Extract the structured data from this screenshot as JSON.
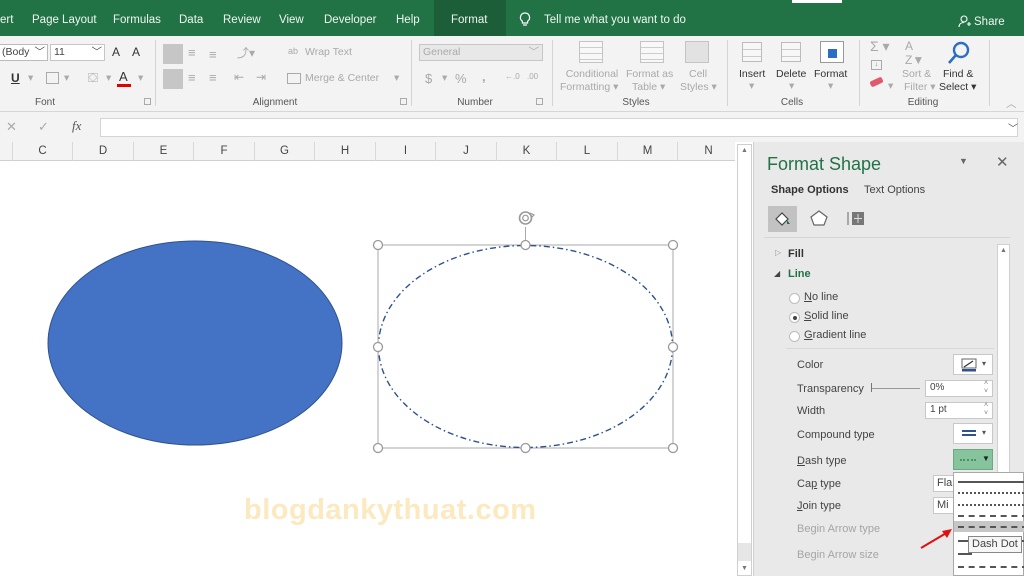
{
  "app": {
    "name": "Excel"
  },
  "tabs": [
    {
      "label": "ert"
    },
    {
      "label": "Page Layout"
    },
    {
      "label": "Formulas"
    },
    {
      "label": "Data"
    },
    {
      "label": "Review"
    },
    {
      "label": "View"
    },
    {
      "label": "Developer"
    },
    {
      "label": "Help"
    },
    {
      "label": "Format",
      "active": true
    }
  ],
  "tell_me": {
    "placeholder": "Tell me what you want to do",
    "icon": "lightbulb-icon"
  },
  "share": {
    "label": "Share",
    "icon": "person-add-icon"
  },
  "ribbon": {
    "font": {
      "label": "Font",
      "font_name": "(Body",
      "font_size": "11",
      "increase_size": "A",
      "decrease_size": "A",
      "underline": "U",
      "font_color_glyph": "A",
      "font_color": "#e00000"
    },
    "alignment": {
      "label": "Alignment",
      "wrap_text": "Wrap Text",
      "merge_center": "Merge & Center"
    },
    "number": {
      "label": "Number",
      "format": "General",
      "currency": "$",
      "percent": "%",
      "comma": ",",
      "inc_decimal": "←0 .00",
      "dec_decimal": ".00 →0"
    },
    "styles": {
      "label": "Styles",
      "conditional_formatting": [
        "Conditional",
        "Formatting ▾"
      ],
      "format_as_table": [
        "Format as",
        "Table ▾"
      ],
      "cell_styles": [
        "Cell",
        "Styles ▾"
      ]
    },
    "cells": {
      "label": "Cells",
      "insert": "Insert",
      "delete": "Delete",
      "format": "Format"
    },
    "editing": {
      "label": "Editing",
      "sort_filter": [
        "Sort &",
        "Filter ▾"
      ],
      "find_select": [
        "Find &",
        "Select ▾"
      ]
    }
  },
  "formula_bar": {
    "cancel": "✕",
    "enter": "✓",
    "fx": "fx",
    "value": ""
  },
  "columns": [
    "C",
    "D",
    "E",
    "F",
    "G",
    "H",
    "I",
    "J",
    "K",
    "L",
    "M",
    "N"
  ],
  "shapes": {
    "filled_oval": {
      "fill": "#4472c4",
      "stroke": "#2f528f"
    },
    "dashed_oval": {
      "stroke": "#2f528f",
      "dash": "Dash Dot",
      "selected": true
    }
  },
  "pane": {
    "title": "Format Shape",
    "title_color": "#217346",
    "tabs": [
      {
        "label": "Shape Options",
        "active": true
      },
      {
        "label": "Text Options"
      }
    ],
    "icons": [
      "fill-line-icon",
      "effects-pentagon-icon",
      "size-properties-icon"
    ],
    "sections": {
      "fill": "Fill",
      "line": "Line"
    },
    "line_options": [
      {
        "label": "No line",
        "accel": "N",
        "checked": false
      },
      {
        "label": "Solid line",
        "accel": "S",
        "checked": true
      },
      {
        "label": "Gradient line",
        "accel": "G",
        "checked": false
      }
    ],
    "properties": {
      "color": "Color",
      "transparency": "Transparency",
      "transparency_value": "0%",
      "width": "Width",
      "width_value": "1 pt",
      "compound_type": "Compound type",
      "dash_type": "Dash type",
      "cap_type": "Cap type",
      "cap_value": "Fla",
      "join_type": "Join type",
      "join_value": "Mi",
      "begin_arrow_type": "Begin Arrow type",
      "begin_arrow_size": "Begin Arrow size"
    },
    "dash_menu": {
      "items": [
        "Solid",
        "Round Dot",
        "Square Dot",
        "Dash",
        "Dash Dot",
        "Long Dash",
        "Long Dash Dot"
      ],
      "hovered": "Dash Dot",
      "tooltip": "Dash Dot"
    }
  },
  "watermark": "blogdankythuat.com"
}
